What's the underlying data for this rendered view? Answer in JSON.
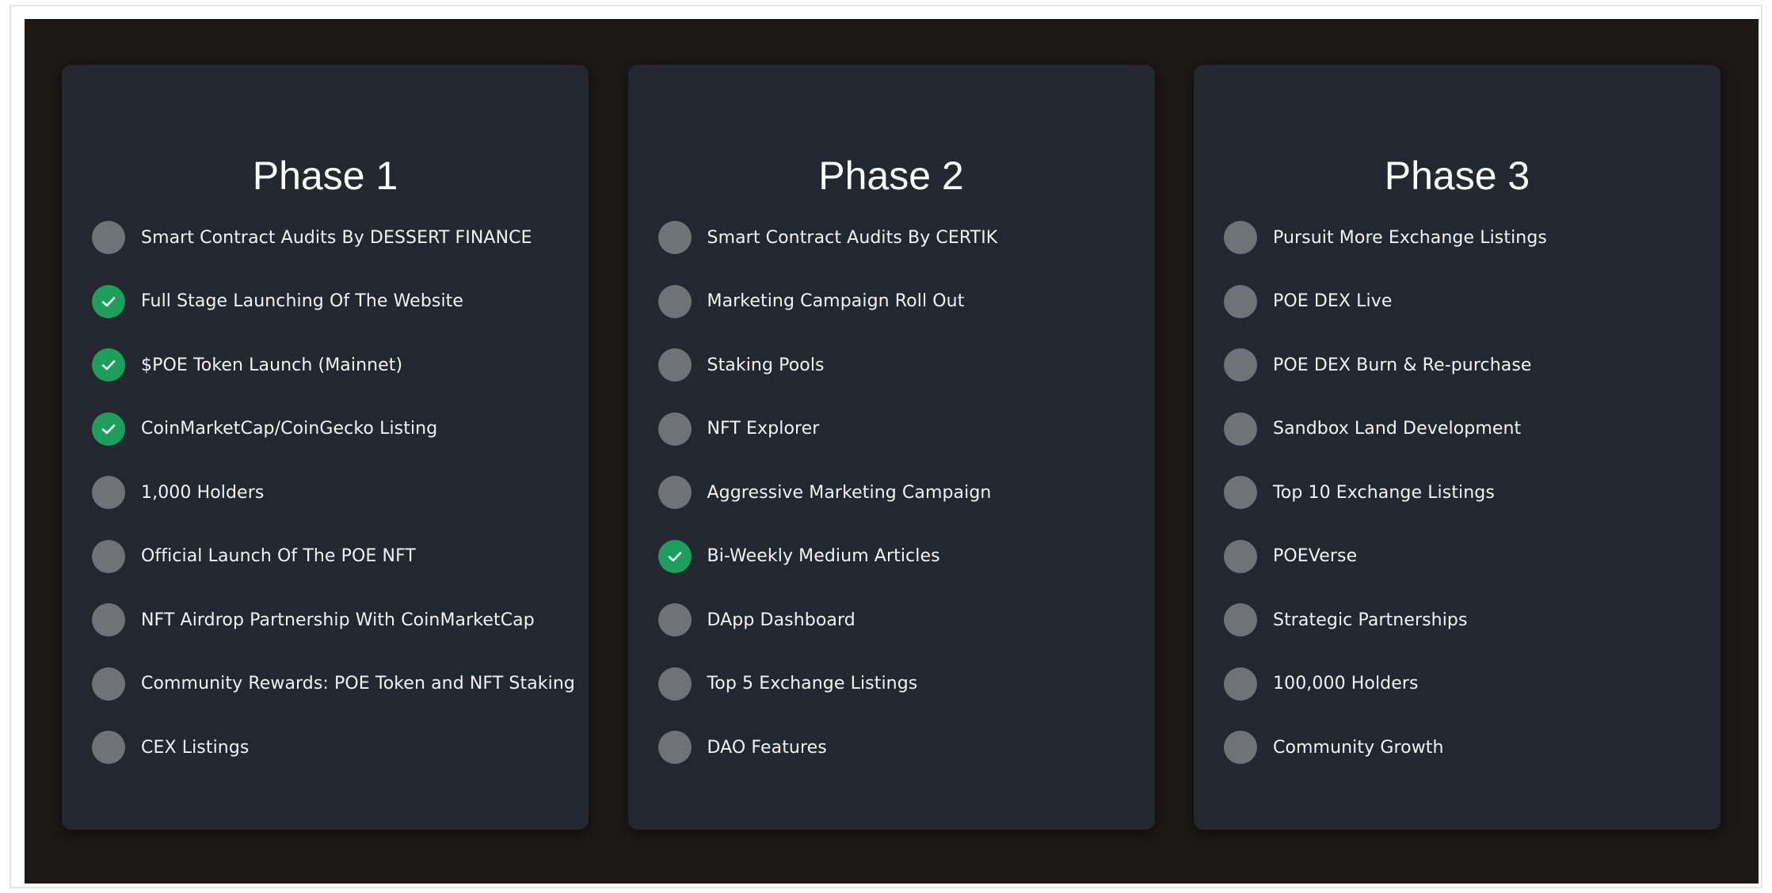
{
  "colors": {
    "page_background": "#1c1917",
    "card_background": "#232830",
    "pending_indicator": "#6f7378",
    "completed_indicator": "#1f9d5c",
    "text": "#f2f2f2"
  },
  "phases": [
    {
      "title": "Phase 1",
      "items": [
        {
          "label": "Smart Contract Audits By DESSERT FINANCE",
          "completed": false
        },
        {
          "label": "Full Stage Launching Of The Website",
          "completed": true
        },
        {
          "label": "$POE Token Launch (Mainnet)",
          "completed": true
        },
        {
          "label": "CoinMarketCap/CoinGecko Listing",
          "completed": true
        },
        {
          "label": "1,000 Holders",
          "completed": false
        },
        {
          "label": "Official Launch Of The POE NFT",
          "completed": false
        },
        {
          "label": "NFT Airdrop Partnership With CoinMarketCap",
          "completed": false
        },
        {
          "label": "Community Rewards: POE Token and NFT Staking",
          "completed": false
        },
        {
          "label": "CEX Listings",
          "completed": false
        }
      ]
    },
    {
      "title": "Phase 2",
      "items": [
        {
          "label": "Smart Contract Audits By CERTIK",
          "completed": false
        },
        {
          "label": "Marketing Campaign Roll Out",
          "completed": false
        },
        {
          "label": "Staking Pools",
          "completed": false
        },
        {
          "label": "NFT Explorer",
          "completed": false
        },
        {
          "label": "Aggressive Marketing Campaign",
          "completed": false
        },
        {
          "label": "Bi-Weekly Medium Articles",
          "completed": true
        },
        {
          "label": "DApp Dashboard",
          "completed": false
        },
        {
          "label": "Top 5 Exchange Listings",
          "completed": false
        },
        {
          "label": "DAO Features",
          "completed": false
        }
      ]
    },
    {
      "title": "Phase 3",
      "items": [
        {
          "label": "Pursuit More Exchange Listings",
          "completed": false
        },
        {
          "label": "POE DEX Live",
          "completed": false
        },
        {
          "label": "POE DEX Burn & Re-purchase",
          "completed": false
        },
        {
          "label": "Sandbox Land Development",
          "completed": false
        },
        {
          "label": "Top 10 Exchange Listings",
          "completed": false
        },
        {
          "label": "POEVerse",
          "completed": false
        },
        {
          "label": "Strategic Partnerships",
          "completed": false
        },
        {
          "label": "100,000 Holders",
          "completed": false
        },
        {
          "label": "Community Growth",
          "completed": false
        }
      ]
    }
  ]
}
